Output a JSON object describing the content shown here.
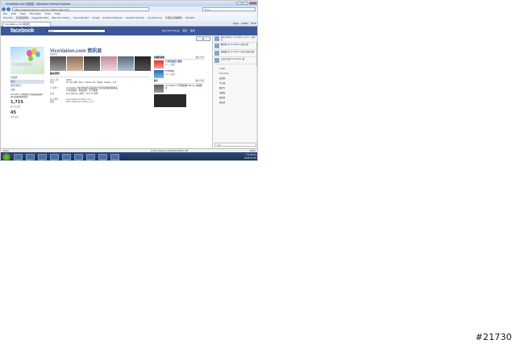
{
  "window": {
    "title": "VicoVation.com 資訊頁 - Windows Internet Explorer"
  },
  "nav": {
    "address": "http://www.facebook.com/VicoVation?sk=info",
    "search_placeholder": "Bing"
  },
  "menu": [
    "File",
    "Edit",
    "View",
    "Favorites",
    "Tools",
    "Help"
  ],
  "favorites": [
    "Favorites",
    "貼到建議網站",
    "Suggested Sites",
    "Web Slice Gallery",
    "Travel Attentiol",
    "Google",
    "Snapshot Marquee",
    "Snapshot Window",
    "goo.gl/abcxyz",
    "台灣最大遊戲網站",
    "Mobile01"
  ],
  "tab": {
    "label": "VicoVation.com 資訊頁"
  },
  "toolbar": [
    "Page",
    "Safety",
    "Tools"
  ],
  "facebook": {
    "logo": "facebook",
    "search_placeholder": "搜尋",
    "user": [
      "Kenneth Chang",
      "首頁",
      "帳號"
    ],
    "brand": "VICOVATION",
    "left_nav": [
      "塗鴉牆",
      "資訊",
      "相片與影片",
      "討論"
    ],
    "intro": "VicoVation 是專業的行車紀錄器品牌，提供高畫質影像紀錄",
    "stats": [
      {
        "count": "1,715",
        "label": "個人說這讚"
      },
      {
        "count": "45",
        "label": "提到這個"
      }
    ],
    "page_title": "VicoVation.com 資訊頁",
    "breadcrumb": "電器用品",
    "like_button": "讚",
    "basic_info_heading": "基本資料",
    "info_rows": [
      {
        "k": "創立日期",
        "v": "2006"
      },
      {
        "k": "地址",
        "v": "3F, No.386, Sec.1, Neihu Rd, Taipei, Taiwan, 114"
      },
      {
        "k": "公司簡介",
        "v": "VicoVation 致力於提供高品質的行車紀錄器與相關產品"
      },
      {
        "k": "",
        "v": "行車紀錄器、影像記錄、安全駕駛"
      },
      {
        "k": "產品",
        "v": "Vico Marcus 系列、Vico TF 系列"
      },
      {
        "k": "電子郵件",
        "v": "service@vicovation.com"
      },
      {
        "k": "網站",
        "v": "http://www.vicovation.com"
      }
    ],
    "right_col": {
      "heading": "相關粉絲團",
      "see_all": "顯示全部",
      "items": [
        {
          "t": "行車紀錄器大聯盟",
          "d": "27 人說讚"
        },
        {
          "t": "CYBIRD",
          "d": "22 人說讚"
        }
      ],
      "video_heading": "影片",
      "video_caption": "VicoVation 行車紀錄器 Marcus 實拍影片"
    }
  },
  "chat": {
    "ticker": [
      {
        "name": "Ken Tsai",
        "msg": "在 VicoVation 分享了一則連結"
      },
      {
        "name": "陳小明",
        "msg": "說 VicoVation 的相片讚"
      },
      {
        "name": "林志強",
        "msg": "對 VicoVation 的貼文發表回應"
      },
      {
        "name": "王大文",
        "msg": "覺得 VicoVation 讚"
      }
    ],
    "friends": [
      "Li Wei",
      "Tina Chen",
      "黃俊傑",
      "李小龍",
      "陳美玲",
      "張國強",
      "劉德華",
      "蔡依林"
    ],
    "search_placeholder": "搜尋"
  },
  "status": {
    "text": "Done",
    "zone": "Local intranet | Protected Mode: Off",
    "zoom": "100%"
  },
  "taskbar": {
    "time": "下午 08:12",
    "date": "2011/12/16"
  },
  "stamp": "#21730"
}
